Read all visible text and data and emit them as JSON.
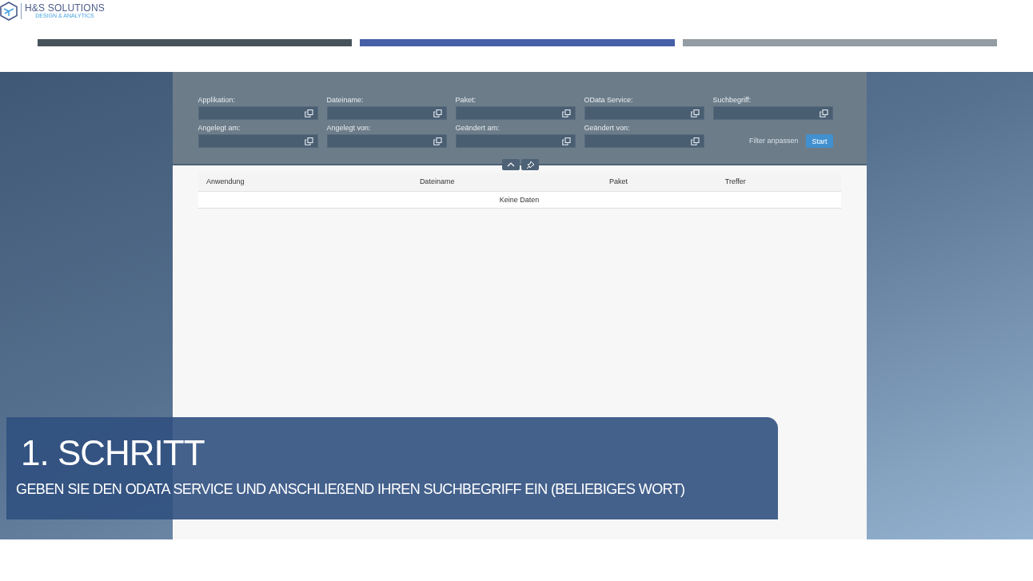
{
  "logo": {
    "name": "H&S SOLUTIONS",
    "tagline": "DESIGN & ANALYTICS"
  },
  "progress_bars": [
    {
      "color": "#47535a"
    },
    {
      "color": "#4660a8"
    },
    {
      "color": "#939ca3"
    }
  ],
  "filter_bar": {
    "fields": [
      {
        "label": "Applikation:"
      },
      {
        "label": "Dateiname:"
      },
      {
        "label": "Paket:"
      },
      {
        "label": "OData Service:"
      },
      {
        "label": "Suchbegriff:"
      },
      {
        "label": "Angelegt am:"
      },
      {
        "label": "Angelegt von:"
      },
      {
        "label": "Geändert am:"
      },
      {
        "label": "Geändert von:"
      }
    ],
    "adapt_link": "Filter anpassen",
    "start_button": "Start"
  },
  "table": {
    "columns": [
      "Anwendung",
      "Dateiname",
      "Paket",
      "Treffer"
    ],
    "no_data": "Keine Daten"
  },
  "caption": {
    "title": "1. SCHRITT",
    "text": "GEBEN SIE DEN ODATA SERVICE UND ANSCHLIEßEND IHREN SUCHBEGRIFF EIN (BELIEBIGES WORT)"
  }
}
